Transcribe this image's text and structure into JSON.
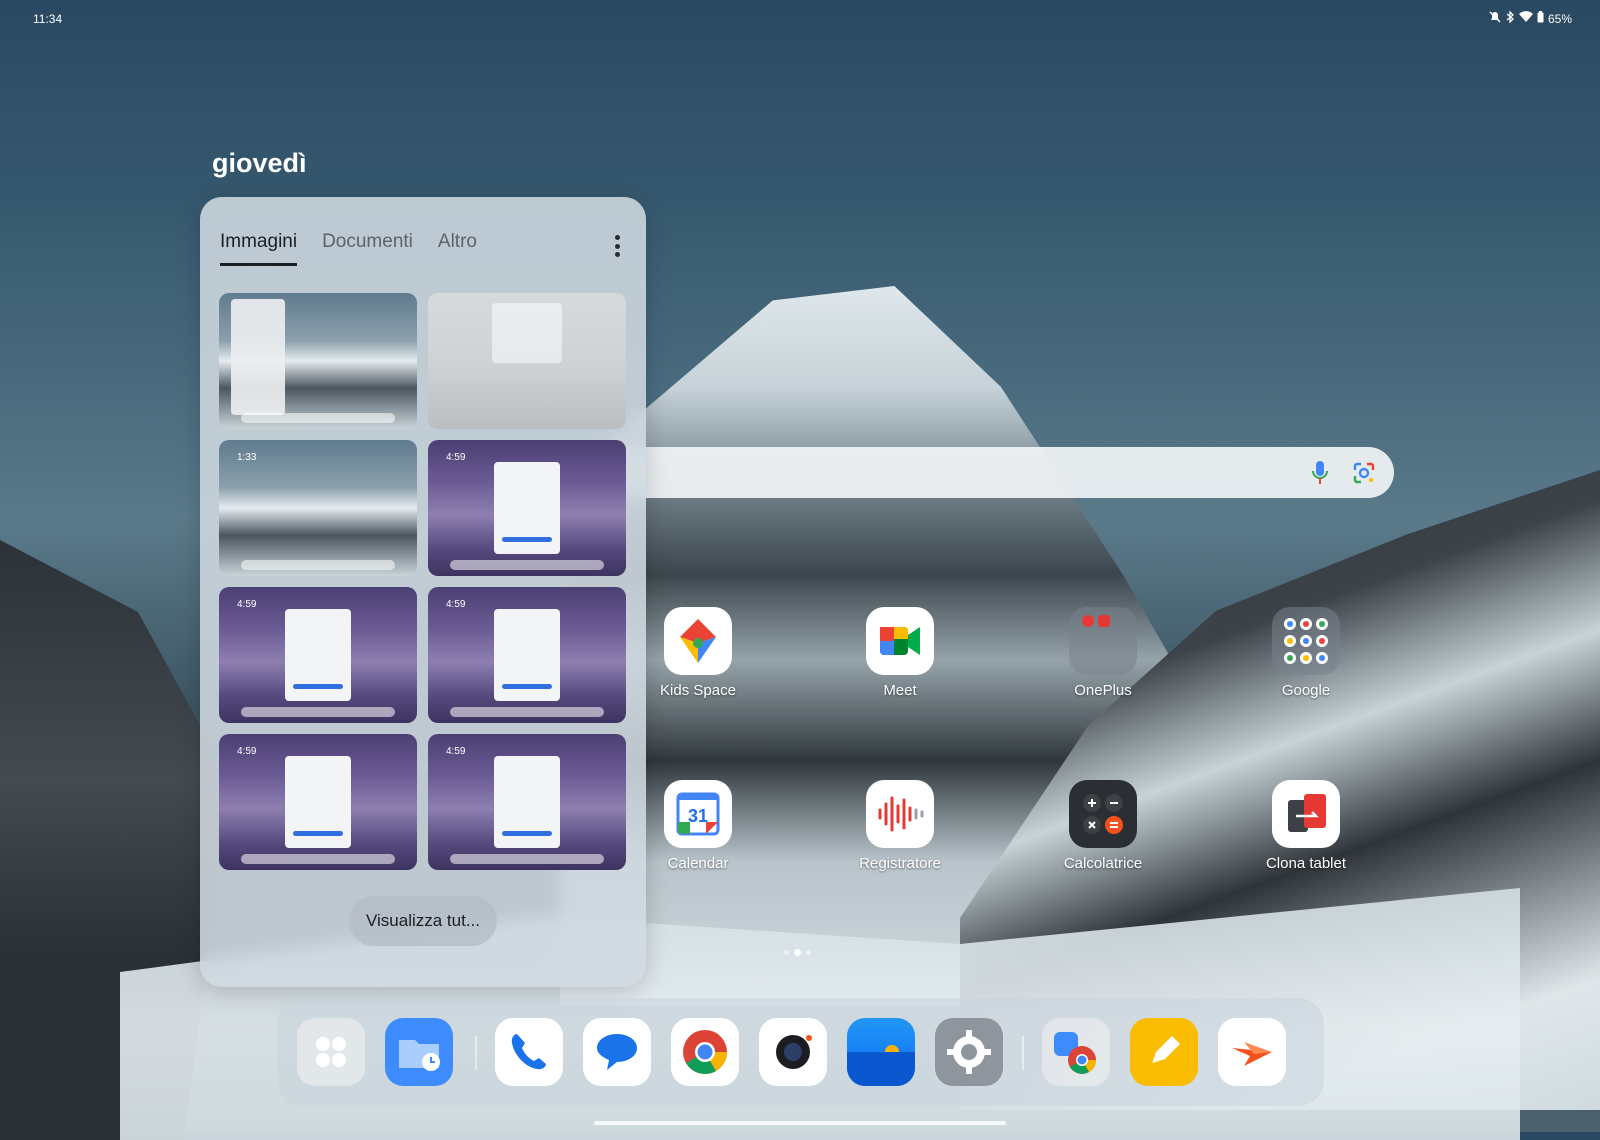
{
  "status": {
    "time": "11:34",
    "battery": "65%",
    "icons": [
      "mute-icon",
      "bluetooth-icon",
      "wifi-icon",
      "battery-icon"
    ]
  },
  "home": {
    "date": "giovedì"
  },
  "panel": {
    "tabs": [
      "Immagini",
      "Documenti",
      "Altro"
    ],
    "active_tab": "Immagini",
    "thumb_time": "4:59",
    "thumb_time_home": "1:33",
    "view_all": "Visualizza tut..."
  },
  "apps": {
    "row1": [
      {
        "label": "Kids Space",
        "icon": "kids-space-icon"
      },
      {
        "label": "Meet",
        "icon": "meet-icon"
      },
      {
        "label": "OnePlus",
        "icon": "folder-icon"
      },
      {
        "label": "Google",
        "icon": "folder-icon"
      }
    ],
    "row2": [
      {
        "label": "Calendar",
        "icon": "calendar-icon",
        "day": "31"
      },
      {
        "label": "Registratore",
        "icon": "recorder-icon"
      },
      {
        "label": "Calcolatrice",
        "icon": "calculator-icon"
      },
      {
        "label": "Clona tablet",
        "icon": "clone-icon"
      }
    ]
  },
  "dock": {
    "items": [
      "app-drawer-icon",
      "file-manager-icon",
      "phone-icon",
      "messages-icon",
      "chrome-icon",
      "camera-icon",
      "photos-icon",
      "settings-icon",
      "recent-chrome-icon",
      "notes-icon",
      "swift-icon"
    ]
  },
  "colors": {
    "accent": "#2f6fe0",
    "panel_bg": "#d0d9e0"
  }
}
